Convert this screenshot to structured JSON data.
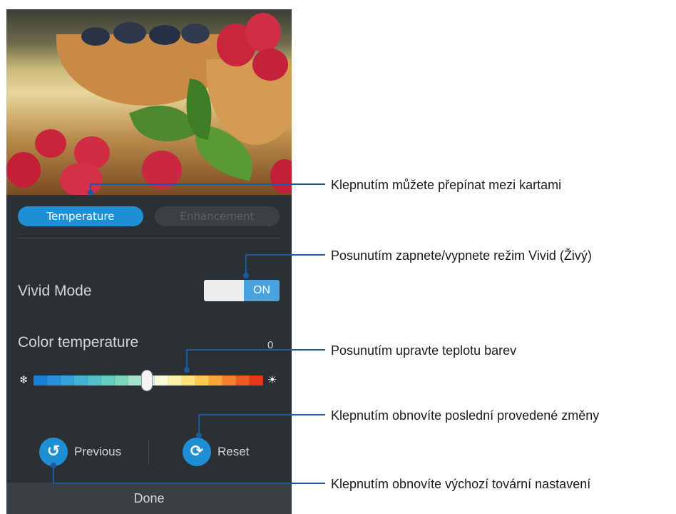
{
  "tabs": {
    "temperature": "Temperature",
    "enhancement": "Enhancement"
  },
  "vivid": {
    "label": "Vivid Mode",
    "toggle_state": "ON"
  },
  "color_temperature": {
    "label": "Color temperature",
    "value": "0"
  },
  "actions": {
    "previous": "Previous",
    "reset": "Reset",
    "done": "Done"
  },
  "callouts": {
    "tabs": "Klepnutím můžete přepínat mezi kartami",
    "vivid": "Posunutím zapnete/vypnete režim Vivid (Živý)",
    "slider": "Posunutím upravte teplotu barev",
    "reset": "Klepnutím obnovíte poslední provedené změny",
    "previous": "Klepnutím obnovíte výchozí tovární nastavení"
  },
  "colors": {
    "accent": "#1e8fd4",
    "panel": "#2b3035",
    "callout_line": "#1a5aa0",
    "gradient": [
      "#1a7fd6",
      "#2a90db",
      "#36a2d9",
      "#44b3d3",
      "#52c2c8",
      "#64cdbe",
      "#7cd6b8",
      "#a7e3c8",
      "#d6f1ec",
      "#fcfadc",
      "#fdf3a8",
      "#fde37a",
      "#fcc84f",
      "#f8a63a",
      "#f3812c",
      "#ee5a21",
      "#e8361a"
    ]
  },
  "icons": {
    "cold": "snowflake-icon",
    "warm": "sun-icon",
    "previous": "undo-icon",
    "reset": "refresh-icon"
  }
}
